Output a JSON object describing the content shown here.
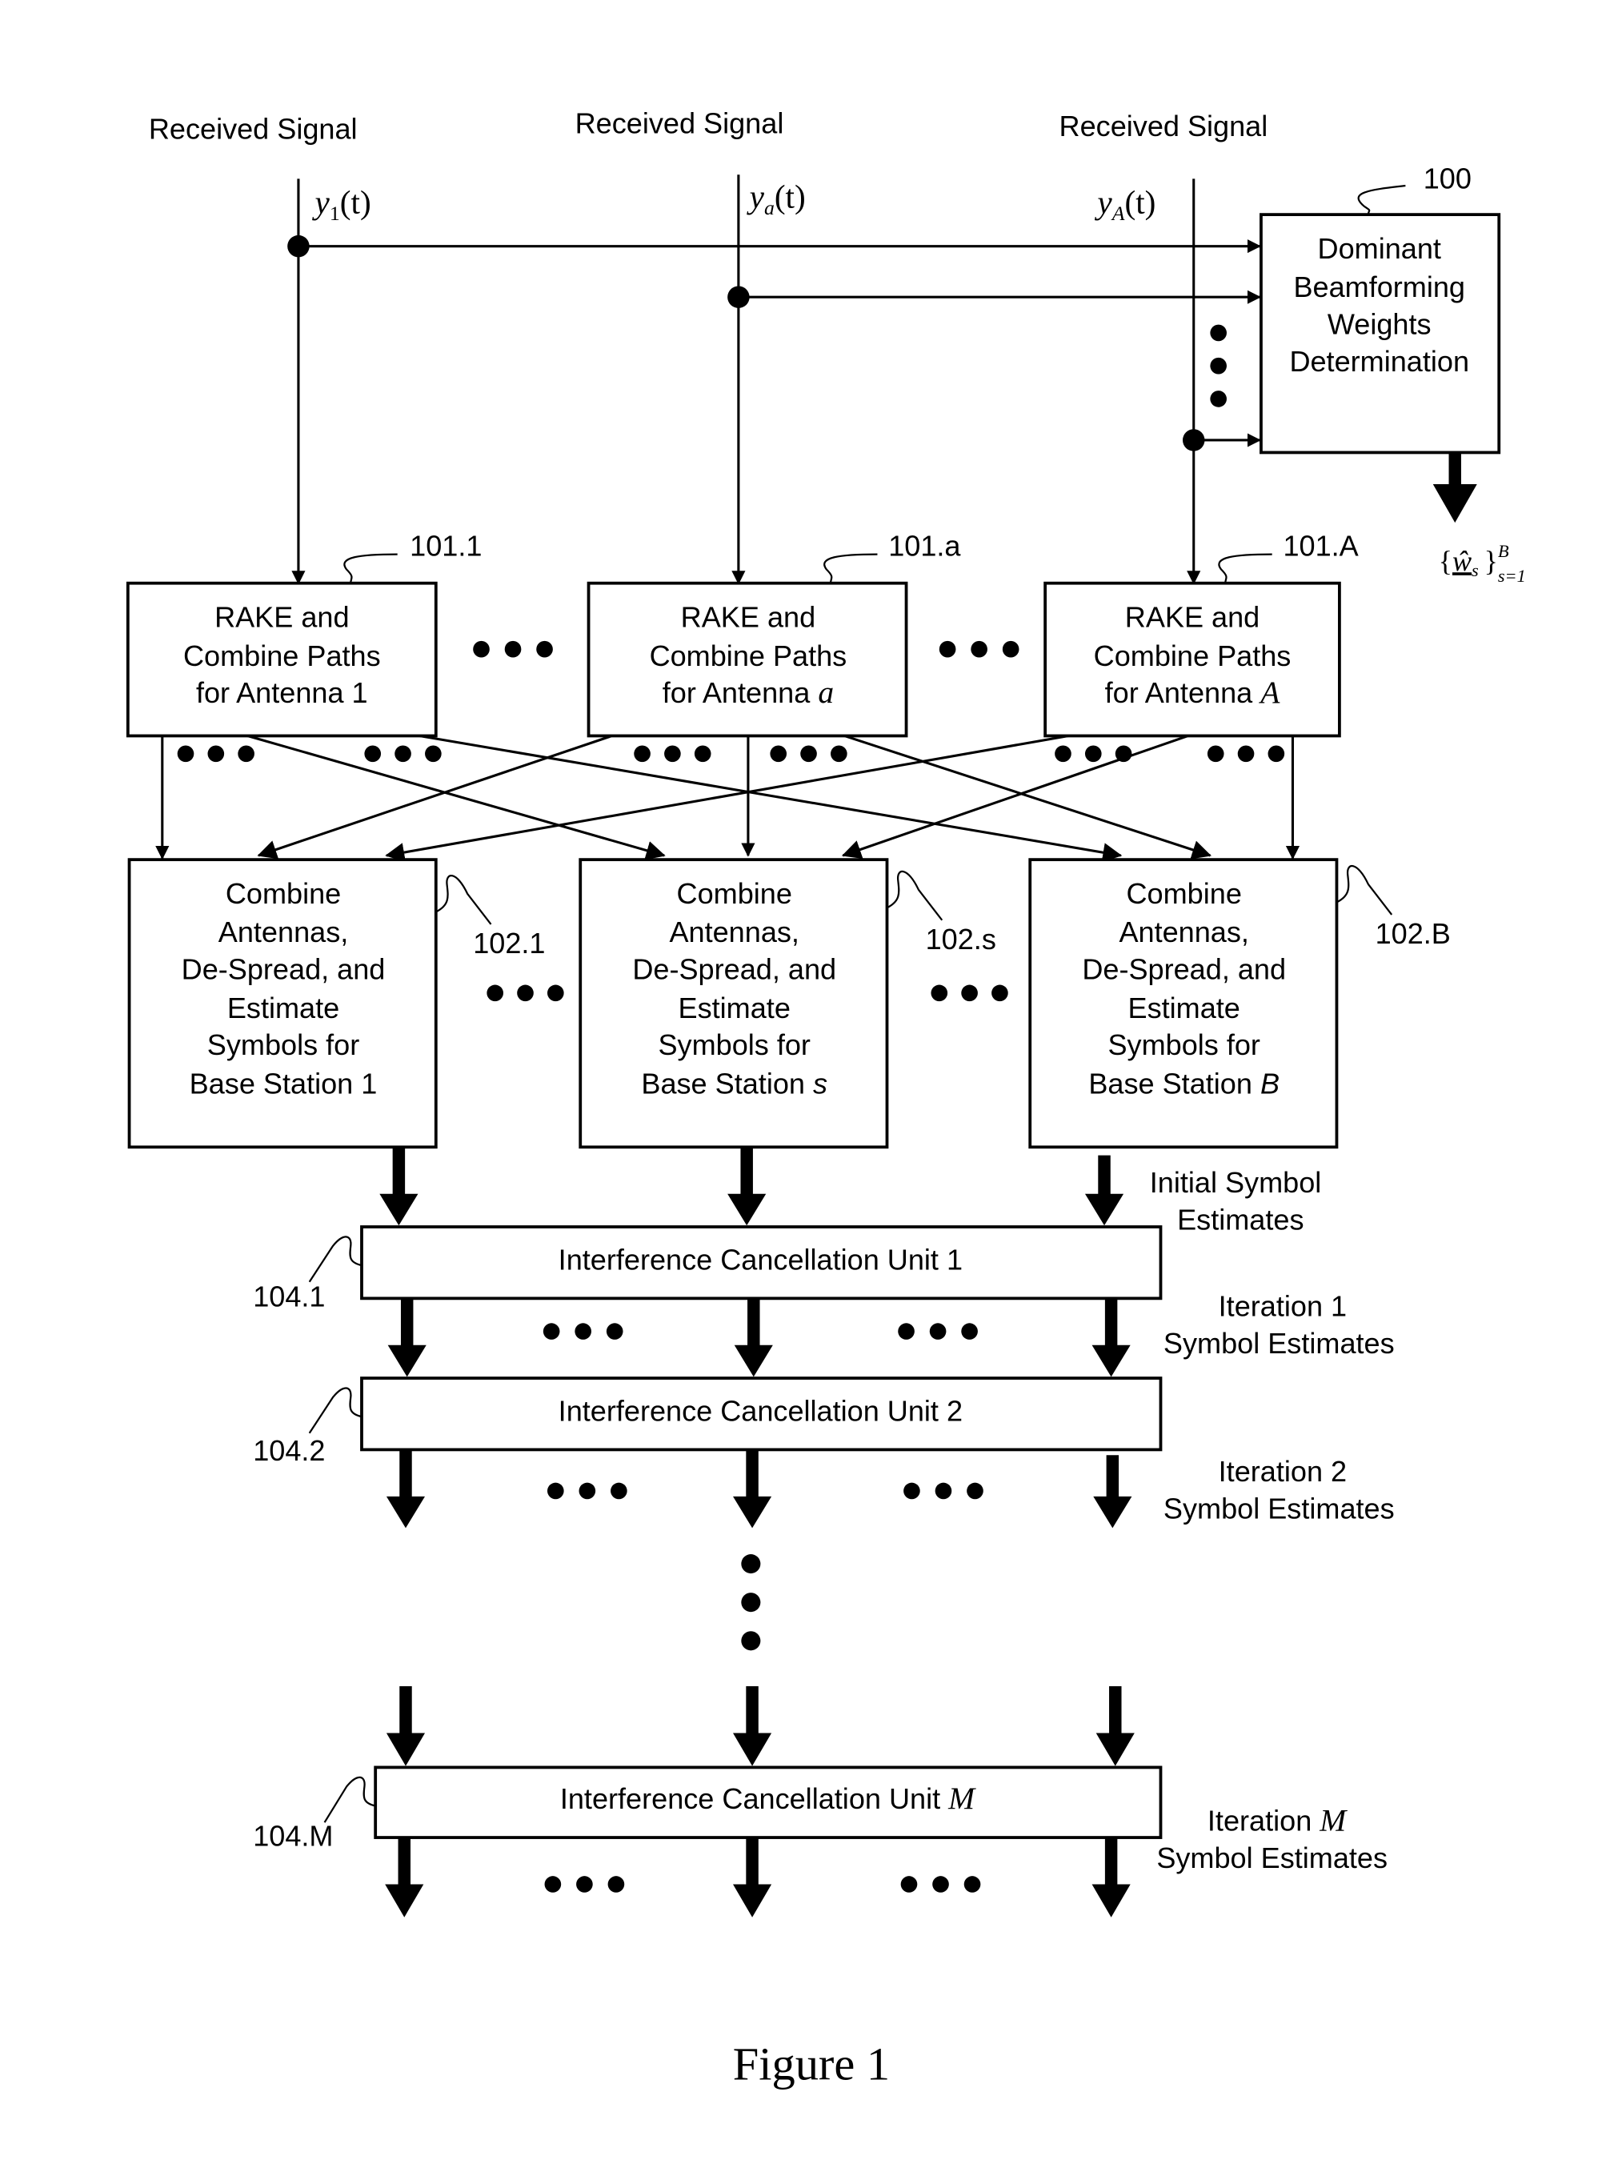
{
  "figure": {
    "caption": "Figure 1",
    "inputs": [
      {
        "header": "Received Signal",
        "signal_base": "y",
        "signal_sub": "1",
        "signal_arg": "(t)"
      },
      {
        "header": "Received Signal",
        "signal_base": "y",
        "signal_sub": "a",
        "signal_arg": "(t)"
      },
      {
        "header": "Received Signal",
        "signal_base": "y",
        "signal_sub": "A",
        "signal_arg": "(t)"
      }
    ],
    "beamforming": {
      "ref": "100",
      "lines": [
        "Dominant",
        "Beamforming",
        "Weights",
        "Determination"
      ],
      "output_label": {
        "brace_open": "{",
        "var": "ŵ",
        "sub": "s",
        "brace_close": "}",
        "sup": "B",
        "range": "s=1"
      }
    },
    "rake_blocks": [
      {
        "ref": "101.1",
        "line1": "RAKE and",
        "line2": "Combine Paths",
        "line3_prefix": "for Antenna ",
        "line3_var": "1",
        "var_italic": false
      },
      {
        "ref": "101.a",
        "line1": "RAKE and",
        "line2": "Combine Paths",
        "line3_prefix": "for Antenna ",
        "line3_var": "a",
        "var_italic": true
      },
      {
        "ref": "101.A",
        "line1": "RAKE and",
        "line2": "Combine Paths",
        "line3_prefix": "for Antenna ",
        "line3_var": "A",
        "var_italic": true
      }
    ],
    "combine_blocks": [
      {
        "ref": "102.1",
        "lines": [
          "Combine",
          "Antennas,",
          "De-Spread, and",
          "Estimate",
          "Symbols for"
        ],
        "last_prefix": "Base Station ",
        "last_var": "1",
        "var_italic": false
      },
      {
        "ref": "102.s",
        "lines": [
          "Combine",
          "Antennas,",
          "De-Spread, and",
          "Estimate",
          "Symbols for"
        ],
        "last_prefix": "Base Station ",
        "last_var": "s",
        "var_italic": true
      },
      {
        "ref": "102.B",
        "lines": [
          "Combine",
          "Antennas,",
          "De-Spread, and",
          "Estimate",
          "Symbols for"
        ],
        "last_prefix": "Base Station ",
        "last_var": "B",
        "var_italic": true
      }
    ],
    "ic_units": [
      {
        "ref": "104.1",
        "label_prefix": "Interference Cancellation Unit ",
        "label_var": "1",
        "var_italic": false,
        "side_line1_prefix": "Iteration ",
        "side_line1_var": "1",
        "side_line2": "Symbol Estimates"
      },
      {
        "ref": "104.2",
        "label_prefix": "Interference Cancellation Unit ",
        "label_var": "2",
        "var_italic": false,
        "side_line1_prefix": "Iteration ",
        "side_line1_var": "2",
        "side_line2": "Symbol Estimates"
      },
      {
        "ref": "104.M",
        "label_prefix": "Interference Cancellation Unit ",
        "label_var": "M",
        "var_italic": true,
        "side_line1_prefix": "Iteration ",
        "side_line1_var": "M",
        "side_line2": "Symbol Estimates"
      }
    ],
    "initial_estimates": {
      "line1": "Initial Symbol",
      "line2": "Estimates"
    }
  }
}
